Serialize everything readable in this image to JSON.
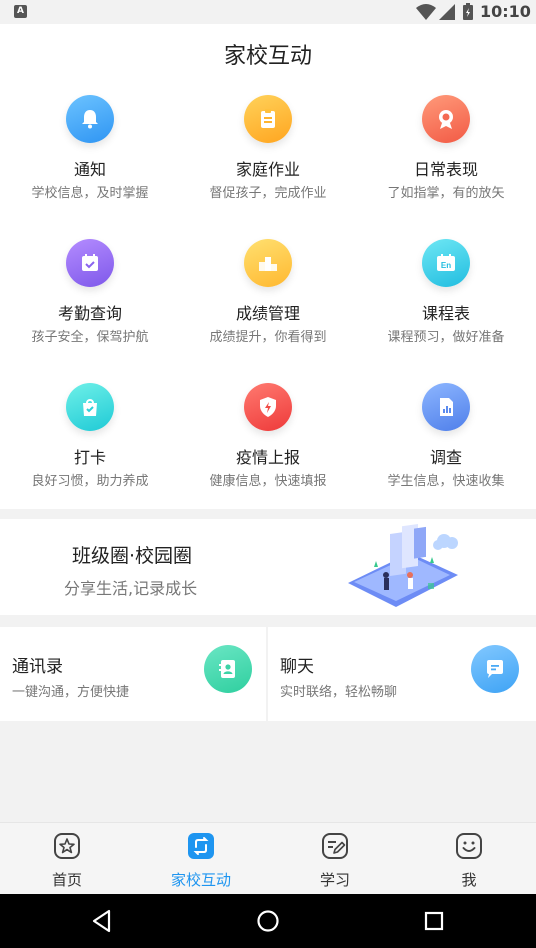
{
  "status_bar": {
    "time": "10:10",
    "notification_icon": "A"
  },
  "header": {
    "title": "家校互动"
  },
  "grid": [
    {
      "label": "通知",
      "sub": "学校信息，及时掌握",
      "icon": "bell-icon",
      "color_from": "#6cc3ff",
      "color_to": "#2f95f3"
    },
    {
      "label": "家庭作业",
      "sub": "督促孩子，完成作业",
      "icon": "homework-icon",
      "color_from": "#ffd25a",
      "color_to": "#ffa520"
    },
    {
      "label": "日常表现",
      "sub": "了如指掌，有的放矢",
      "icon": "award-icon",
      "color_from": "#ff9a7a",
      "color_to": "#f25a45"
    },
    {
      "label": "考勤查询",
      "sub": "孩子安全，保驾护航",
      "icon": "calendar-check-icon",
      "color_from": "#b48cff",
      "color_to": "#7e58ea"
    },
    {
      "label": "成绩管理",
      "sub": "成绩提升，你看得到",
      "icon": "podium-icon",
      "color_from": "#ffe070",
      "color_to": "#ffb830"
    },
    {
      "label": "课程表",
      "sub": "课程预习，做好准备",
      "icon": "calendar-en-icon",
      "color_from": "#6ee7f4",
      "color_to": "#21bde0"
    },
    {
      "label": "打卡",
      "sub": "良好习惯，助力养成",
      "icon": "checkin-bag-icon",
      "color_from": "#6ff0e8",
      "color_to": "#1fcad6"
    },
    {
      "label": "疫情上报",
      "sub": "健康信息，快速填报",
      "icon": "shield-icon",
      "color_from": "#ff7a70",
      "color_to": "#ee3a3a"
    },
    {
      "label": "调查",
      "sub": "学生信息，快速收集",
      "icon": "survey-icon",
      "color_from": "#8db6ff",
      "color_to": "#4f7fea"
    }
  ],
  "banner": {
    "title": "班级圈·校园圈",
    "subtitle": "分享生活,记录成长"
  },
  "cards": [
    {
      "title": "通讯录",
      "sub": "一键沟通，方便快捷",
      "icon": "contacts-icon",
      "color_from": "#6ae6c4",
      "color_to": "#2fcf9f"
    },
    {
      "title": "聊天",
      "sub": "实时联络，轻松畅聊",
      "icon": "chat-icon",
      "color_from": "#82c8ff",
      "color_to": "#3ea3f5"
    }
  ],
  "bottom_nav": [
    {
      "label": "首页",
      "icon": "home-star-icon",
      "active": false
    },
    {
      "label": "家校互动",
      "icon": "interaction-icon",
      "active": true
    },
    {
      "label": "学习",
      "icon": "study-icon",
      "active": false
    },
    {
      "label": "我",
      "icon": "smile-icon",
      "active": false
    }
  ],
  "colors": {
    "accent": "#1e95f0",
    "background": "#f2f2f2"
  }
}
